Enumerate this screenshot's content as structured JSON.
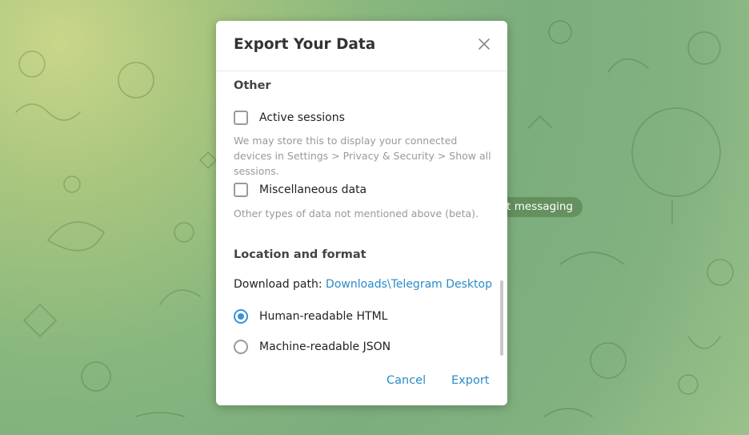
{
  "background": {
    "pill_text": "rt messaging"
  },
  "dialog": {
    "title": "Export Your Data",
    "close_icon": "close-icon",
    "sections": {
      "other": {
        "title": "Other",
        "active_sessions": {
          "label": "Active sessions",
          "checked": false,
          "description": "We may store this to display your connected devices in Settings > Privacy & Security > Show all sessions."
        },
        "misc": {
          "label": "Miscellaneous data",
          "checked": false,
          "description": "Other types of data not mentioned above (beta)."
        }
      },
      "location": {
        "title": "Location and format",
        "download_path_label": "Download path:",
        "download_path_value": "Downloads\\Telegram Desktop",
        "formats": [
          {
            "label": "Human-readable HTML",
            "selected": true
          },
          {
            "label": "Machine-readable JSON",
            "selected": false
          }
        ]
      }
    },
    "buttons": {
      "cancel": "Cancel",
      "export": "Export"
    },
    "accent_color": "#2a8bc9"
  }
}
